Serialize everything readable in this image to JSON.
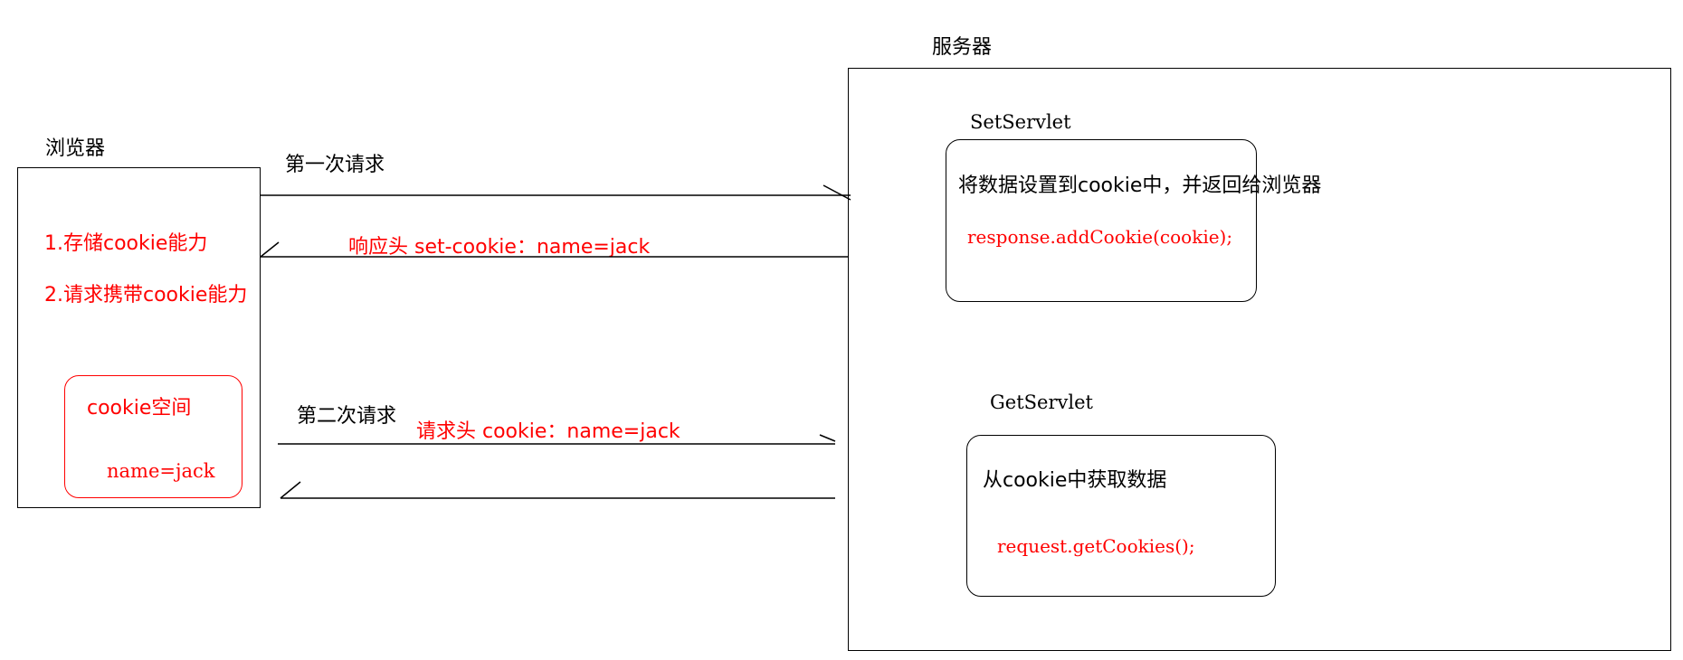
{
  "browser": {
    "title": "浏览器",
    "capability_1": "1.存储cookie能力",
    "capability_2": "2.请求携带cookie能力",
    "cookie_space": {
      "title": "cookie空间",
      "value": "name=jack"
    }
  },
  "server": {
    "title": "服务器",
    "set_servlet": {
      "name": "SetServlet",
      "description": "将数据设置到cookie中，并返回给浏览器",
      "code": "response.addCookie(cookie);"
    },
    "get_servlet": {
      "name": "GetServlet",
      "description": "从cookie中获取数据",
      "code": "request.getCookies();"
    }
  },
  "arrows": {
    "first_request": "第一次请求",
    "response_header": "响应头 set-cookie：name=jack",
    "second_request": "第二次请求",
    "request_header": "请求头 cookie：name=jack"
  },
  "colors": {
    "annotation": "#ff0000",
    "line": "#000000"
  }
}
